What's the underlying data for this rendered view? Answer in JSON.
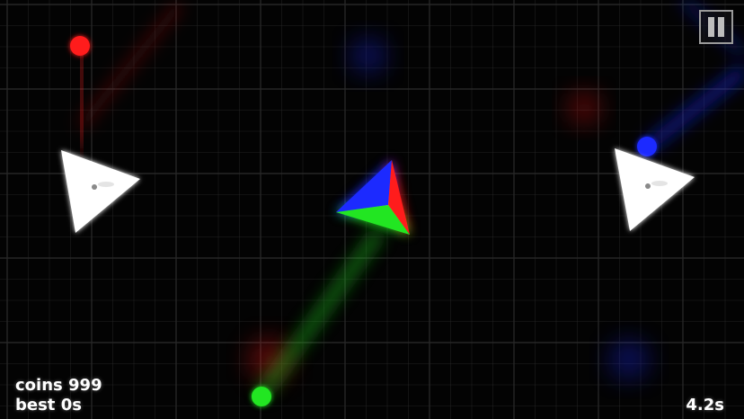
{
  "hud": {
    "coins_label": "coins",
    "coins_value": "999",
    "best_label": "best",
    "best_value": "0s",
    "timer": "4.2s"
  },
  "controls": {
    "pause_icon": "pause-icon"
  },
  "colors": {
    "background": "#030303",
    "grid": "#2a2a2a",
    "red": "#ff1a1a",
    "green": "#22e622",
    "blue": "#1a2bff",
    "enemy": "#ffffff"
  },
  "scene": {
    "player": "rgb-tri-color-triangle",
    "orbs": [
      "red-orb",
      "green-orb",
      "blue-orb"
    ],
    "enemies": [
      "white-triangle-enemy",
      "white-triangle-enemy"
    ]
  }
}
